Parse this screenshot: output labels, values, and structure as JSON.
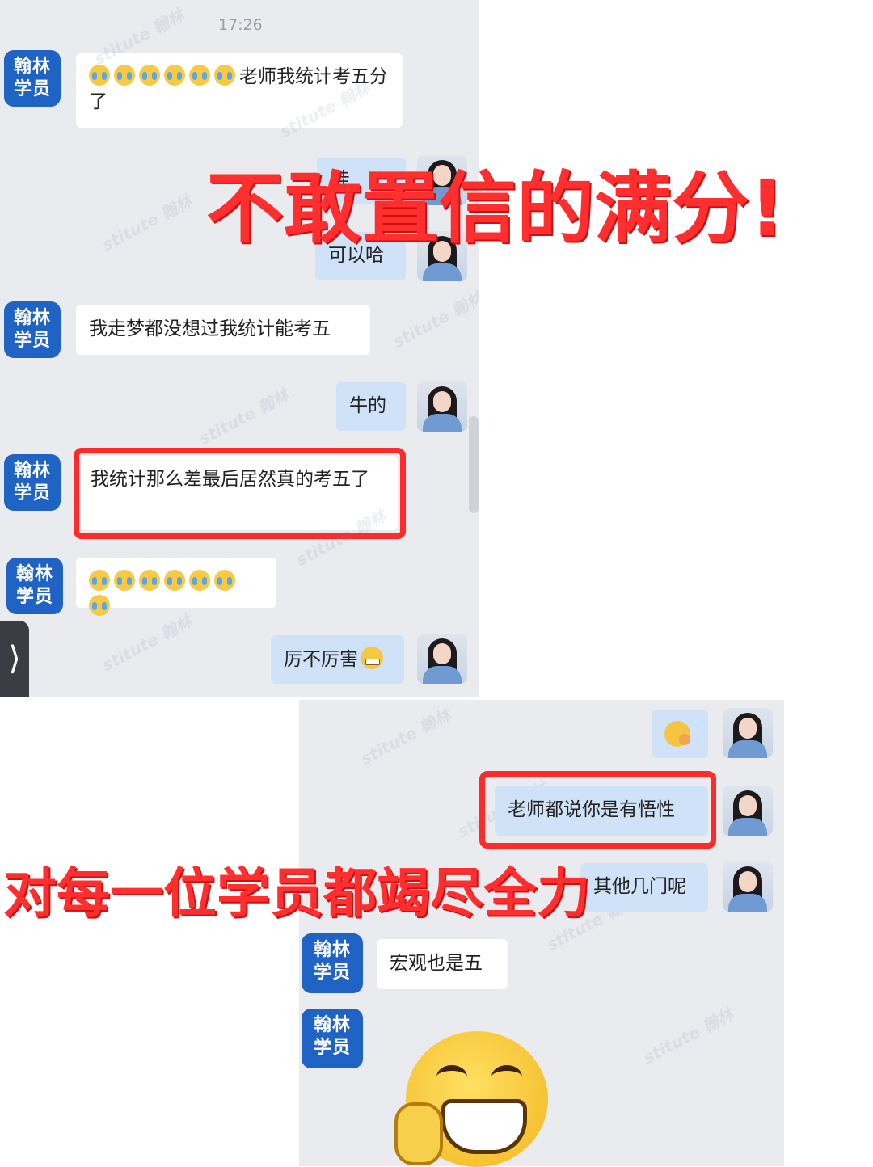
{
  "status_time": "17:26",
  "overlays": {
    "top_title": "不敢置信的满分!",
    "bottom_title": "对每一位学员都竭尽全力"
  },
  "student_avatar": {
    "line1": "翰林",
    "line2": "学员"
  },
  "top_chat": {
    "m1_text": "老师我统计考五分了",
    "m2_partial": "哇",
    "m3_text": "可以哈",
    "m4_text": "我走梦都没想过我统计能考五",
    "m5_text": "牛的",
    "m6_text": "我统计那么差最后居然真的考五了",
    "m8_text": "厉不厉害"
  },
  "bottom_chat": {
    "m2_text": "老师都说你是有悟性",
    "m3_text": "其他几门呢",
    "m4_text": "宏观也是五"
  },
  "colors": {
    "accent_red": "#ff2a2a",
    "student_avatar_blue": "#1f63c4",
    "outgoing_bubble": "#cfe2f7",
    "chat_bg": "#e9ebef"
  }
}
